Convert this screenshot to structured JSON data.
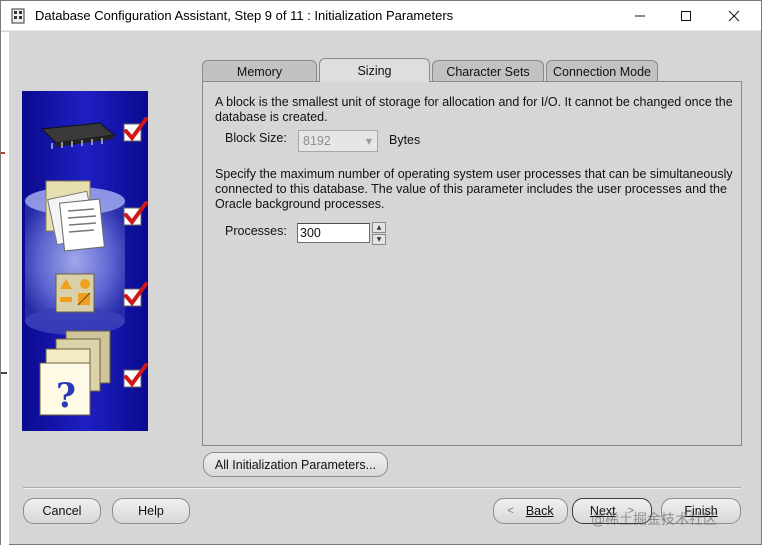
{
  "window": {
    "title": "Database Configuration Assistant, Step 9 of 11 : Initialization Parameters",
    "minimize_glyph": "—",
    "maximize_glyph": "☐",
    "close_glyph": "✕"
  },
  "tabs": [
    {
      "label": "Memory",
      "active": false
    },
    {
      "label": "Sizing",
      "active": true
    },
    {
      "label": "Character Sets",
      "active": false
    },
    {
      "label": "Connection Mode",
      "active": false
    }
  ],
  "sizing": {
    "block_description": "A block is the smallest unit of storage for allocation and for I/O. It cannot be changed once the database is created.",
    "block_size_label": "Block Size:",
    "block_size_value": "8192",
    "block_size_unit": "Bytes",
    "processes_description": "Specify the maximum number of operating system user processes that can be simultaneously connected to this database. The value of this parameter includes the user processes and the Oracle background processes.",
    "processes_label": "Processes:",
    "processes_value": "300"
  },
  "buttons": {
    "all_params": "All Initialization Parameters...",
    "cancel": "Cancel",
    "help": "Help",
    "back": "Back",
    "next": "Next",
    "finish": "Finish"
  },
  "steps_graphic": {
    "icons": [
      "memory-chip-icon",
      "documents-icon",
      "shapes-icon",
      "help-folder-icon"
    ],
    "checks": [
      true,
      true,
      true,
      true
    ]
  },
  "watermark": "@稀土掘金技术社区",
  "colors": {
    "window_bg": "#d6d6d6",
    "graphic_blue": "#1a1aa8",
    "check_red": "#d01818"
  }
}
